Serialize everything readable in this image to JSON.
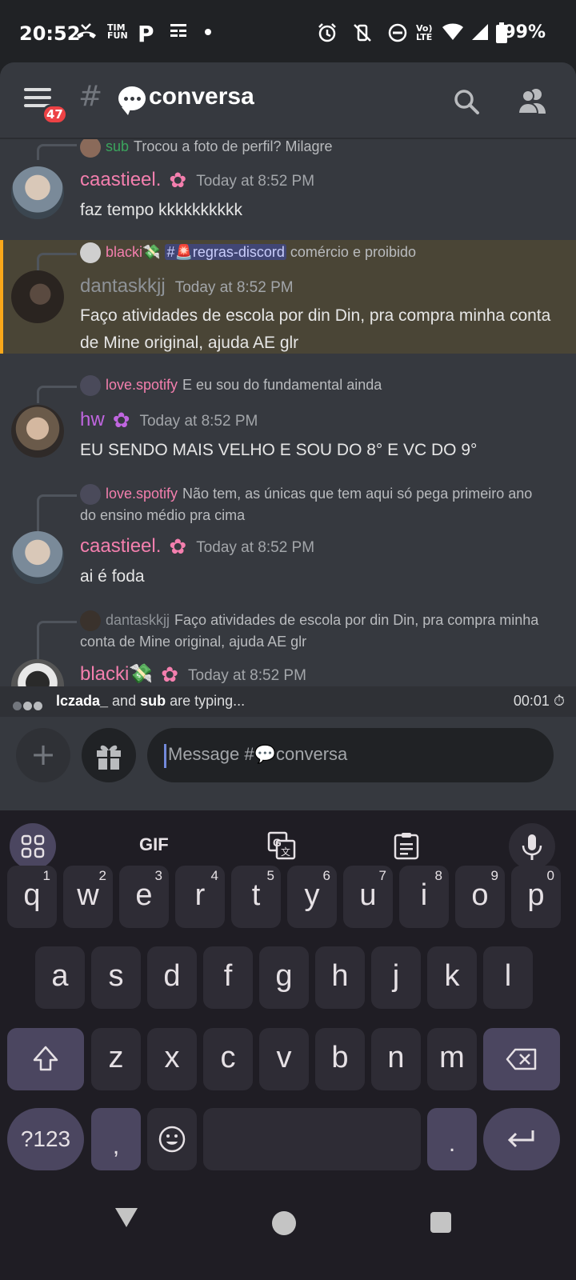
{
  "status_bar": {
    "time": "20:52",
    "carrier_icon": "TIM FUN",
    "battery": "99%",
    "icons": [
      "alarm-icon",
      "vibrate-off-icon",
      "dnd-icon",
      "volte-icon",
      "wifi-icon",
      "signal-icon",
      "battery-icon"
    ]
  },
  "header": {
    "badge": "47",
    "hash": "#",
    "channel_name": "conversa"
  },
  "messages": [
    {
      "reply_author": "sub",
      "reply_author_color": "#3ba55d",
      "reply_text": "Trocou a foto de perfil? Milagre"
    },
    {
      "author": "caastieel.",
      "author_color": "#f47fae",
      "timestamp": "Today at 8:52 PM",
      "text": "faz tempo kkkkkkkkkk"
    },
    {
      "reply_author": "blacki💸",
      "reply_author_color": "#f47fae",
      "reply_channel": "#🚨regras-discord",
      "reply_text": "comércio e proibido",
      "author": "dantaskkjj",
      "author_color": "#8e9297",
      "timestamp": "Today at 8:52 PM",
      "text": "Faço atividades de escola por din Din, pra compra minha conta de Mine original, ajuda AE glr"
    },
    {
      "reply_author": "love.spotify",
      "reply_author_color": "#f47fae",
      "reply_text": "E eu sou do fundamental ainda",
      "author": "hw",
      "author_color": "#c066e0",
      "timestamp": "Today at 8:52 PM",
      "text": "EU SENDO MAIS VELHO E SOU DO 8° E VC DO 9°"
    },
    {
      "reply_author": "love.spotify",
      "reply_author_color": "#f47fae",
      "reply_text": "Não tem, as únicas que tem aqui só pega primeiro ano do ensino médio pra cima",
      "author": "caastieel.",
      "author_color": "#f47fae",
      "timestamp": "Today at 8:52 PM",
      "text": "ai é foda"
    },
    {
      "reply_author": "dantaskkjj",
      "reply_author_color": "#8e9297",
      "reply_text": "Faço atividades de escola por din Din, pra compra minha conta de Mine original, ajuda AE glr",
      "author": "blacki💸",
      "author_color": "#f47fae",
      "timestamp": "Today at 8:52 PM"
    }
  ],
  "typing": {
    "user1": "lczada_",
    "and": " and ",
    "user2": "sub",
    "suffix": " are typing...",
    "timer": "00:01"
  },
  "composer": {
    "placeholder": "Message #💬conversa"
  },
  "keyboard": {
    "toolbar": [
      "apps-grid-icon",
      "GIF",
      "translate-icon",
      "clipboard-icon",
      "mic-icon"
    ],
    "gif_label": "GIF",
    "row1": [
      {
        "k": "q",
        "n": "1"
      },
      {
        "k": "w",
        "n": "2"
      },
      {
        "k": "e",
        "n": "3"
      },
      {
        "k": "r",
        "n": "4"
      },
      {
        "k": "t",
        "n": "5"
      },
      {
        "k": "y",
        "n": "6"
      },
      {
        "k": "u",
        "n": "7"
      },
      {
        "k": "i",
        "n": "8"
      },
      {
        "k": "o",
        "n": "9"
      },
      {
        "k": "p",
        "n": "0"
      }
    ],
    "row2": [
      "a",
      "s",
      "d",
      "f",
      "g",
      "h",
      "j",
      "k",
      "l"
    ],
    "row3": [
      "z",
      "x",
      "c",
      "v",
      "b",
      "n",
      "m"
    ],
    "symbols_label": "?123",
    "comma": ",",
    "period": "."
  }
}
